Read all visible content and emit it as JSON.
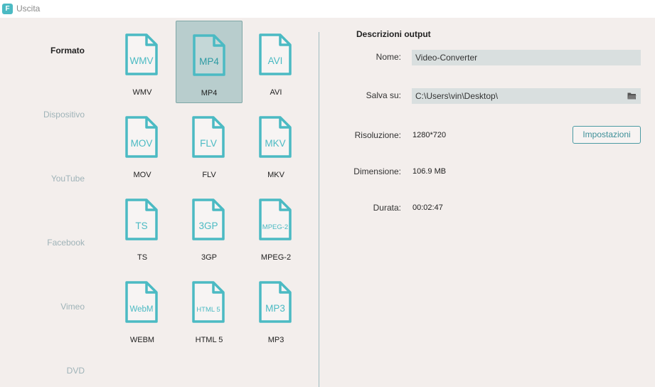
{
  "app": {
    "title": "Uscita",
    "logo_letter": "F"
  },
  "sidebar": {
    "categories": [
      {
        "label": "Formato",
        "active": true
      },
      {
        "label": "Dispositivo",
        "active": false
      },
      {
        "label": "YouTube",
        "active": false
      },
      {
        "label": "Facebook",
        "active": false
      },
      {
        "label": "Vimeo",
        "active": false
      },
      {
        "label": "DVD",
        "active": false
      }
    ]
  },
  "formats": [
    {
      "icon_text": "WMV",
      "label": "WMV",
      "selected": false
    },
    {
      "icon_text": "MP4",
      "label": "MP4",
      "selected": true
    },
    {
      "icon_text": "AVI",
      "label": "AVI",
      "selected": false
    },
    {
      "icon_text": "MOV",
      "label": "MOV",
      "selected": false
    },
    {
      "icon_text": "FLV",
      "label": "FLV",
      "selected": false
    },
    {
      "icon_text": "MKV",
      "label": "MKV",
      "selected": false
    },
    {
      "icon_text": "TS",
      "label": "TS",
      "selected": false
    },
    {
      "icon_text": "3GP",
      "label": "3GP",
      "selected": false
    },
    {
      "icon_text": "MPEG-2",
      "label": "MPEG-2",
      "selected": false
    },
    {
      "icon_text": "WebM",
      "label": "WEBM",
      "selected": false
    },
    {
      "icon_text": "HTML 5",
      "label": "HTML 5",
      "selected": false
    },
    {
      "icon_text": "MP3",
      "label": "MP3",
      "selected": false
    }
  ],
  "output": {
    "title": "Descrizioni output",
    "name_label": "Nome:",
    "name_value": "Video-Converter",
    "save_label": "Salva su:",
    "save_value": "C:\\Users\\vin\\Desktop\\",
    "resolution_label": "Risoluzione:",
    "resolution_value": "1280*720",
    "settings_button": "Impostazioni",
    "size_label": "Dimensione:",
    "size_value": "106.9 MB",
    "duration_label": "Durata:",
    "duration_value": "00:02:47"
  },
  "colors": {
    "accent": "#4bbac3",
    "selected_bg": "#b8cdcd",
    "background": "#f3eeec"
  },
  "icons": {
    "folder": "folder-icon",
    "file": "file-format-icon"
  }
}
